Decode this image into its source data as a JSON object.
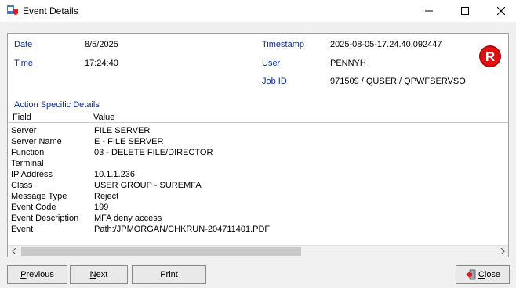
{
  "window": {
    "title": "Event Details",
    "controls": {
      "minimize": "—",
      "maximize": "☐",
      "close": "✕"
    }
  },
  "header": {
    "date_label": "Date",
    "date_value": "8/5/2025",
    "time_label": "Time",
    "time_value": "17:24:40",
    "timestamp_label": "Timestamp",
    "timestamp_value": "2025-08-05-17.24.40.092447",
    "user_label": "User",
    "user_value": "PENNYH",
    "jobid_label": "Job ID",
    "jobid_value": "971509 / QUSER / QPWFSERVSO",
    "badge_letter": "R",
    "badge_color": "#e01010"
  },
  "details": {
    "section_title": "Action Specific Details",
    "columns": [
      "Field",
      "Value"
    ],
    "rows": [
      {
        "field": "Server",
        "value": "FILE SERVER"
      },
      {
        "field": "Server Name",
        "value": "E - FILE SERVER"
      },
      {
        "field": "Function",
        "value": "03 - DELETE FILE/DIRECTOR"
      },
      {
        "field": "Terminal",
        "value": ""
      },
      {
        "field": "IP Address",
        "value": "10.1.1.236"
      },
      {
        "field": "Class",
        "value": "USER GROUP - SUREMFA"
      },
      {
        "field": "Message Type",
        "value": "Reject"
      },
      {
        "field": "Event Code",
        "value": "199"
      },
      {
        "field": "Event Description",
        "value": "MFA deny access"
      },
      {
        "field": "Event",
        "value": "Path:/JPMORGAN/CHKRUN-204711401.PDF"
      }
    ]
  },
  "buttons": {
    "previous_first": "P",
    "previous_rest": "revious",
    "next_first": "N",
    "next_rest": "ext",
    "print": "Print",
    "close_first": "C",
    "close_rest": "lose"
  },
  "icons": {
    "app": "event-details-app-icon",
    "close_button_icon": "exit-door-icon",
    "scroll_left": "chevron-left-icon",
    "scroll_right": "chevron-right-icon"
  }
}
